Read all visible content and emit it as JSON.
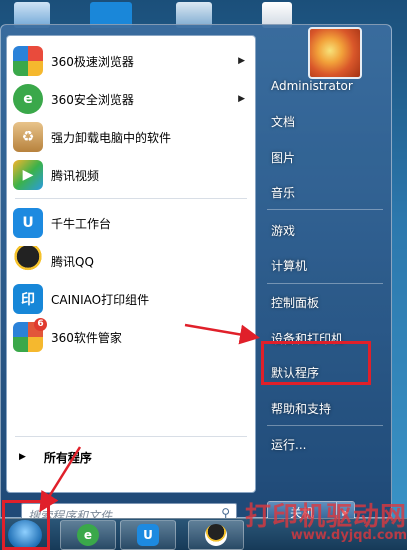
{
  "programs": [
    {
      "label": "360极速浏览器",
      "icon": "360-speed-browser-icon",
      "color": "#e94b3c",
      "submenu": true
    },
    {
      "label": "360安全浏览器",
      "icon": "360-safe-browser-icon",
      "color": "#3aa84a",
      "submenu": true
    },
    {
      "label": "强力卸载电脑中的软件",
      "icon": "uninstall-box-icon",
      "color": "#c98a3a",
      "submenu": false
    },
    {
      "label": "腾讯视频",
      "icon": "tencent-video-icon",
      "color": "#2b9be0",
      "submenu": false
    },
    {
      "label": "千牛工作台",
      "icon": "qianniu-icon",
      "color": "#1d8ae0",
      "submenu": false
    },
    {
      "label": "腾讯QQ",
      "icon": "qq-penguin-icon",
      "color": "#222222",
      "submenu": false
    },
    {
      "label": "CAINIAO打印组件",
      "icon": "cainiao-print-icon",
      "color": "#1787d8",
      "submenu": false
    },
    {
      "label": "360软件管家",
      "icon": "360-software-manager-icon",
      "color": "#e2563a",
      "submenu": false,
      "badge": "6"
    }
  ],
  "all_programs": "所有程序",
  "search_placeholder": "搜索程序和文件",
  "right_items": [
    {
      "label": "Administrator"
    },
    {
      "label": "文档"
    },
    {
      "label": "图片"
    },
    {
      "label": "音乐"
    },
    {
      "label": "游戏"
    },
    {
      "label": "计算机"
    },
    {
      "label": "控制面板"
    },
    {
      "label": "设备和打印机"
    },
    {
      "label": "默认程序"
    },
    {
      "label": "帮助和支持"
    },
    {
      "label": "运行..."
    }
  ],
  "shutdown_label": "关机",
  "watermark": "打印机驱动网",
  "watermark_url": "www.dyjqd.com",
  "highlight_color": "#e0202a"
}
